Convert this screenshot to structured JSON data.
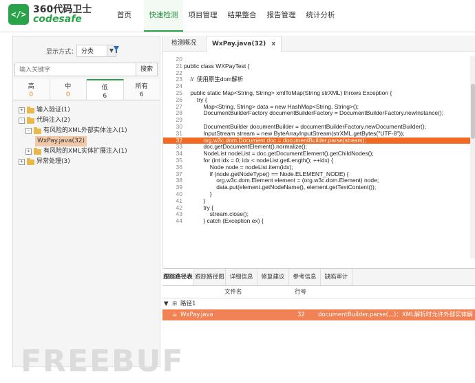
{
  "app": {
    "logo_icon": "</>",
    "logo_cn": "360代码卫士",
    "logo_en": "codesafe"
  },
  "nav": [
    {
      "label": "首页"
    },
    {
      "label": "快速检测",
      "active": true
    },
    {
      "label": "项目管理"
    },
    {
      "label": "结果整合"
    },
    {
      "label": "报告管理"
    },
    {
      "label": "统计分析"
    }
  ],
  "sidebar": {
    "display_label": "显示方式：",
    "display_value": "分类",
    "search_placeholder": "输入关键字",
    "search_button": "搜索",
    "severity": [
      {
        "label": "高",
        "count": "0"
      },
      {
        "label": "中",
        "count": "0"
      },
      {
        "label": "低",
        "count": "6"
      },
      {
        "label": "所有",
        "count": "6"
      }
    ],
    "tree": [
      {
        "label": "输入验证(1)"
      },
      {
        "label": "代码注入(2)"
      },
      {
        "label": "有风险的XML外部实体注入(1)"
      },
      {
        "label": "WxPay.java(32)"
      },
      {
        "label": "有风险的XML实体扩展注入(1)"
      },
      {
        "label": "异常处理(3)"
      }
    ]
  },
  "code_tabs": {
    "overview": "检测概况",
    "file": "WxPay.java(32)",
    "close": "x"
  },
  "code": [
    {
      "n": "20",
      "t": ""
    },
    {
      "n": "21",
      "t": "public class WXPayTest {"
    },
    {
      "n": "22",
      "t": ""
    },
    {
      "n": "23",
      "t": "    //  使用原生dom解析"
    },
    {
      "n": "24",
      "t": ""
    },
    {
      "n": "25",
      "t": "    public static Map<String, String> xmlToMap(String strXML) throws Exception {"
    },
    {
      "n": "26",
      "t": "        try {"
    },
    {
      "n": "27",
      "t": "            Map<String, String> data = new HashMap<String, String>();"
    },
    {
      "n": "28",
      "t": "            DocumentBuilderFactory documentBuilderFactory = DocumentBuilderFactory.newInstance();"
    },
    {
      "n": "29",
      "t": ""
    },
    {
      "n": "30",
      "t": "            DocumentBuilder documentBuilder = documentBuilderFactory.newDocumentBuilder();"
    },
    {
      "n": "31",
      "t": "            InputStream stream = new ByteArrayInputStream(strXML.getBytes(\"UTF-8\"));"
    },
    {
      "n": "32",
      "t": "            org.w3c.dom.Document doc = documentBuilder.parse(stream);"
    },
    {
      "n": "33",
      "t": "            doc.getDocumentElement().normalize();"
    },
    {
      "n": "34",
      "t": "            NodeList nodeList = doc.getDocumentElement().getChildNodes();"
    },
    {
      "n": "35",
      "t": "            for (int idx = 0; idx < nodeList.getLength(); ++idx) {"
    },
    {
      "n": "36",
      "t": "                Node node = nodeList.item(idx);"
    },
    {
      "n": "37",
      "t": "                if (node.getNodeType() == Node.ELEMENT_NODE) {"
    },
    {
      "n": "38",
      "t": "                    org.w3c.dom.Element element = (org.w3c.dom.Element) node;"
    },
    {
      "n": "39",
      "t": "                    data.put(element.getNodeName(), element.getTextContent());"
    },
    {
      "n": "40",
      "t": "                }"
    },
    {
      "n": "41",
      "t": "            }"
    },
    {
      "n": "42",
      "t": "            try {"
    },
    {
      "n": "43",
      "t": "                stream.close();"
    },
    {
      "n": "44",
      "t": "            } catch (Exception ex) {"
    }
  ],
  "highlight_line": "32",
  "bottom_tabs": [
    "跟踪路径表",
    "跟踪路径图",
    "详细信息",
    "修复建议",
    "参考信息",
    "缺陷审计"
  ],
  "table": {
    "col_file": "文件名",
    "col_line": "行号",
    "path_label": "路径1",
    "row": {
      "file": "WxPay.java",
      "line": "32",
      "desc": "documentBuilder.parse(...)：XML解析时允许外部实体解析"
    }
  },
  "watermark": "FREEBUF"
}
